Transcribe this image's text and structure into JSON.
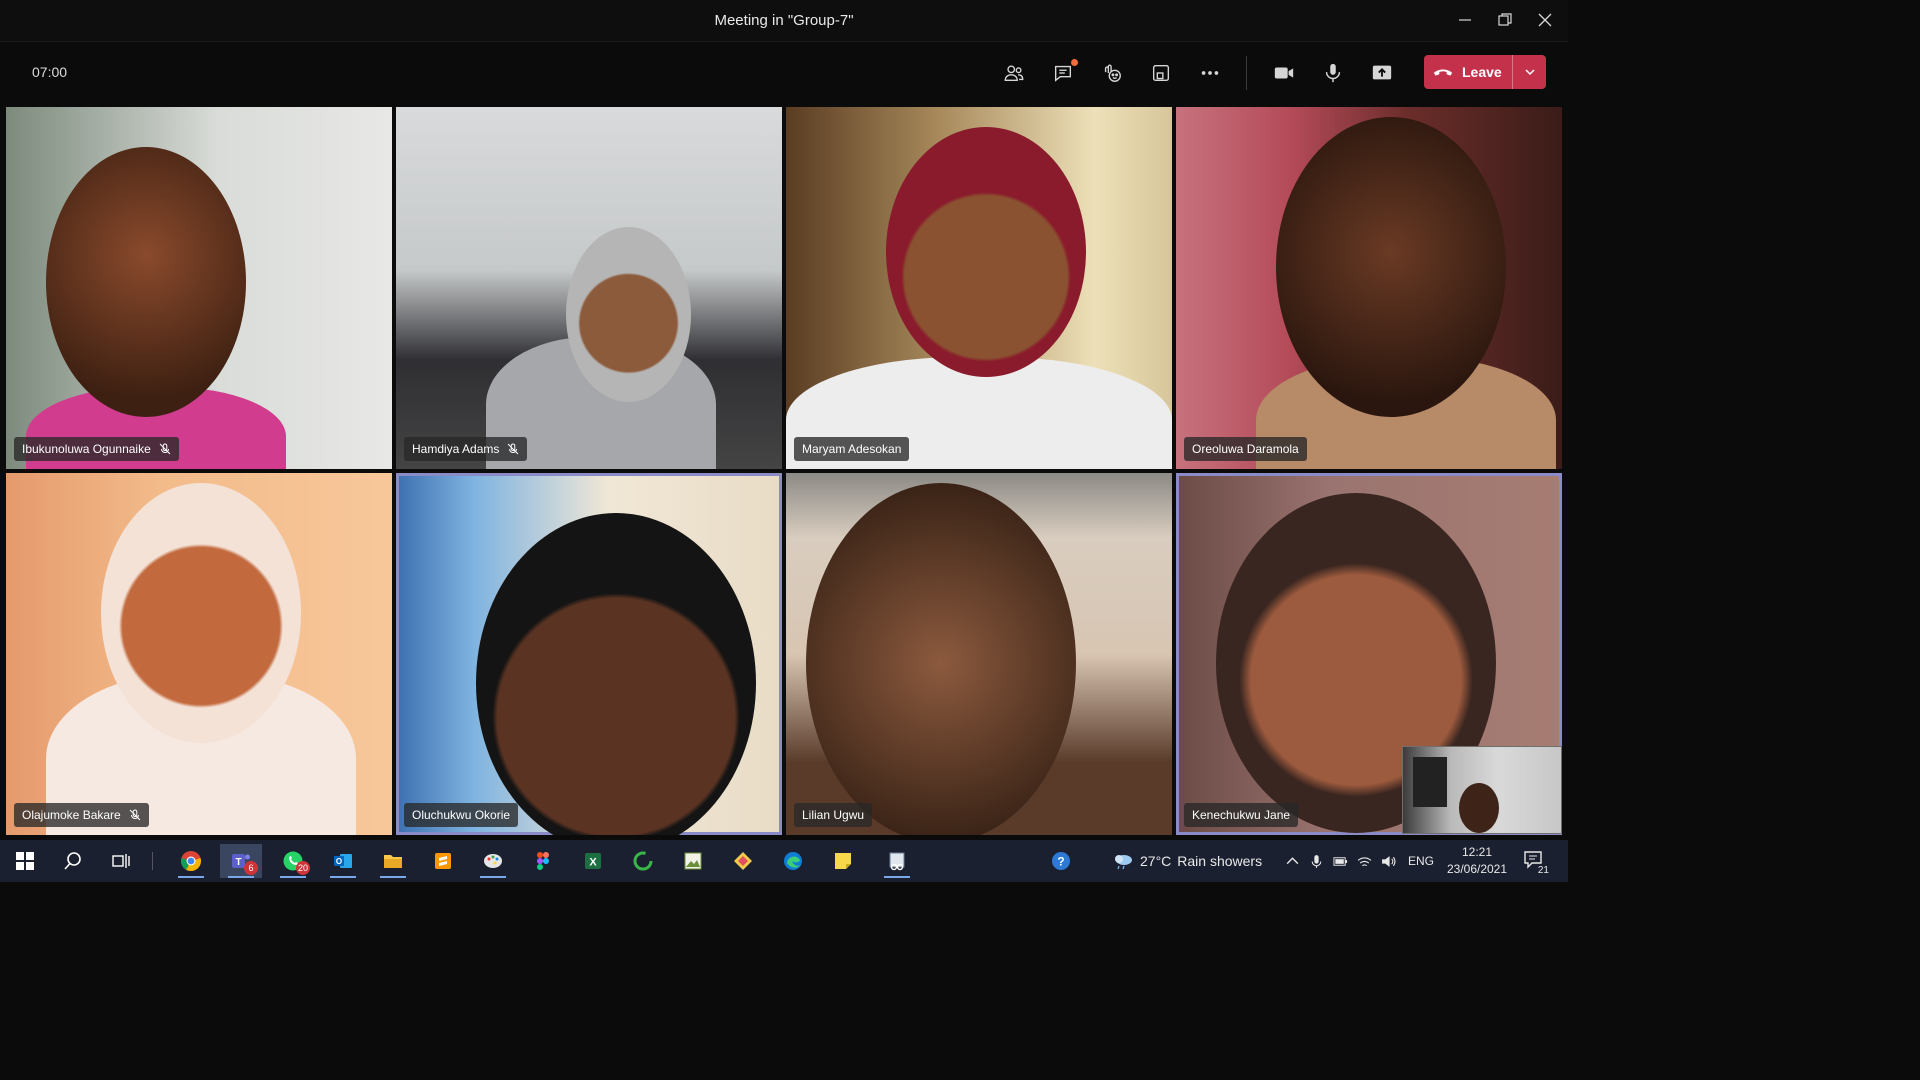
{
  "window": {
    "title": "Meeting in \"Group-7\""
  },
  "toolbar": {
    "timer": "07:00",
    "leave_label": "Leave",
    "buttons": [
      "participants-icon",
      "chat-icon",
      "reactions-icon",
      "rooms-icon",
      "more-icon",
      "camera-icon",
      "mic-icon",
      "share-icon"
    ]
  },
  "participants": [
    {
      "name": "Ibukunoluwa Ogunnaike",
      "muted": true,
      "active": false
    },
    {
      "name": "Hamdiya Adams",
      "muted": true,
      "active": false
    },
    {
      "name": "Maryam Adesokan",
      "muted": false,
      "active": false
    },
    {
      "name": "Oreoluwa Daramola",
      "muted": false,
      "active": false
    },
    {
      "name": "Olajumoke Bakare",
      "muted": true,
      "active": false
    },
    {
      "name": "Oluchukwu Okorie",
      "muted": false,
      "active": true
    },
    {
      "name": "Lilian Ugwu",
      "muted": false,
      "active": false
    },
    {
      "name": "Kenechukwu Jane",
      "muted": false,
      "active": true
    }
  ],
  "taskbar": {
    "teams_badge": "6",
    "whatsapp_badge": "20",
    "weather": {
      "temp": "27°C",
      "desc": "Rain showers"
    },
    "language": "ENG",
    "time": "12:21",
    "date": "23/06/2021",
    "notifications": "21"
  },
  "colors": {
    "leave": "#c4314b",
    "active_outline": "#8b8cc7",
    "taskbar": "#1b2030"
  }
}
